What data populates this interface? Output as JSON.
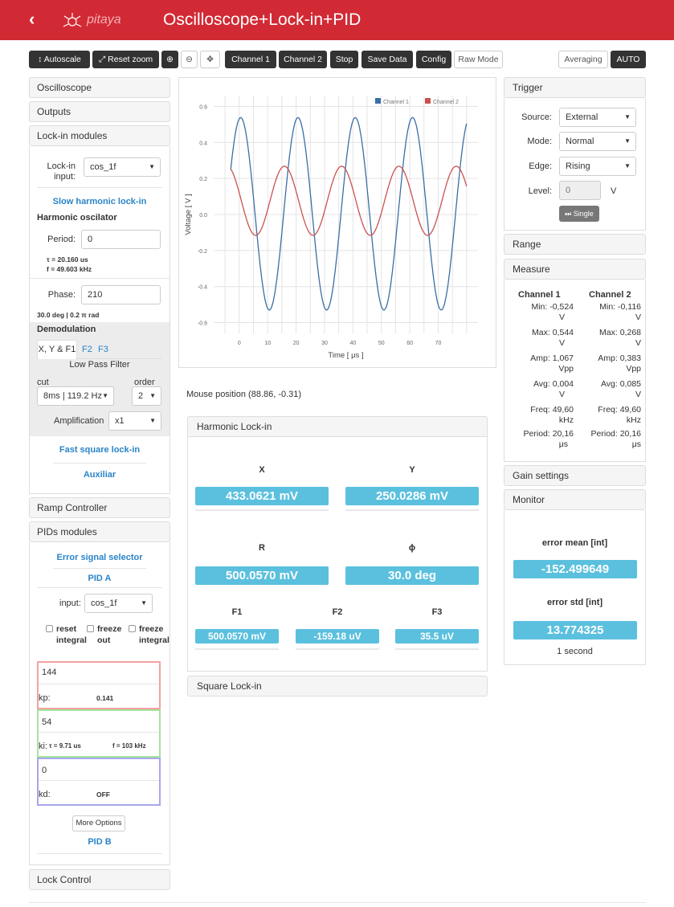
{
  "header": {
    "back_icon": "‹",
    "brand": "pitaya",
    "title": "Oscilloscope+Lock-in+PID"
  },
  "toolbar": {
    "autoscale": "Autoscale",
    "reset_zoom": "Reset zoom",
    "channel1": "Channel 1",
    "channel2": "Channel 2",
    "stop": "Stop",
    "save_data": "Save Data",
    "config": "Config",
    "raw_mode": "Raw Mode",
    "averaging": "Averaging",
    "auto": "AUTO"
  },
  "left": {
    "oscilloscope": "Oscilloscope",
    "outputs": "Outputs",
    "lockin_modules": "Lock-in modules",
    "lockin_input_label": "Lock-in",
    "lockin_input_label2": "input:",
    "lockin_input_value": "cos_1f",
    "slow_harmonic": "Slow harmonic lock-in",
    "harmonic_osc": "Harmonic oscilator",
    "period_label": "Period:",
    "period_value": "0",
    "tau": "τ = 20.160 us",
    "freq": "f = 49.603 kHz",
    "phase_label": "Phase:",
    "phase_value": "210",
    "phase_info": "30.0 deg | 0.2 π rad",
    "demodulation": "Demodulation",
    "tabs": [
      "X, Y & F1",
      "F2",
      "F3"
    ],
    "lpf": "Low Pass Filter",
    "cut_label": "cut",
    "order_label": "order",
    "cut_value": "8ms | 119.2 Hz",
    "order_value": "2",
    "amp_label": "Amplification",
    "amp_value": "x1",
    "fast_square": "Fast square lock-in",
    "auxiliar": "Auxiliar",
    "ramp": "Ramp Controller",
    "pids": "PIDs modules",
    "err_selector": "Error signal selector",
    "pid_a": "PID A",
    "pid_input_label": "input:",
    "pid_input_value": "cos_1f",
    "reset": "reset",
    "integral": "integral",
    "freeze": "freeze",
    "out": "out",
    "freeze2": "freeze",
    "integral2": "integral",
    "kp_value": "144",
    "kp_label": "kp:",
    "kp_info": "0.141",
    "ki_value": "54",
    "ki_label": "ki:",
    "ki_tau": "τ = 9.71 us",
    "ki_f": "f = 103 kHz",
    "kd_value": "0",
    "kd_label": "kd:",
    "kd_info": "OFF",
    "more_options": "More Options",
    "pid_b": "PID B",
    "lock_control": "Lock Control"
  },
  "mouse_position": "Mouse position (88.86, -0.31)",
  "harmonic": {
    "title": "Harmonic Lock-in",
    "x_label": "X",
    "x_value": "433.0621 mV",
    "y_label": "Y",
    "y_value": "250.0286 mV",
    "r_label": "R",
    "r_value": "500.0570 mV",
    "phi_label": "ϕ",
    "phi_value": "30.0  deg",
    "f1_label": "F1",
    "f1_value": "500.0570 mV",
    "f2_label": "F2",
    "f2_value": "-159.18 uV",
    "f3_label": "F3",
    "f3_value": "35.5 uV"
  },
  "square_lockin": "Square Lock-in",
  "trigger": {
    "title": "Trigger",
    "source_label": "Source:",
    "source_value": "External",
    "mode_label": "Mode:",
    "mode_value": "Normal",
    "edge_label": "Edge:",
    "edge_value": "Rising",
    "level_label": "Level:",
    "level_value": "0",
    "level_unit": "V",
    "single": "Single"
  },
  "range": "Range",
  "measure": {
    "title": "Measure",
    "ch1": "Channel 1",
    "ch2": "Channel 2",
    "min1": "Min: -0,524",
    "min2": "Min: -0,116",
    "max1": "Max: 0,544",
    "max2": "Max: 0,268",
    "amp1": "Amp: 1,067",
    "amp2": "Amp: 0,383",
    "avg1": "Avg: 0,004",
    "avg2": "Avg: 0,085",
    "freq1": "Freq: 49,60",
    "freq2": "Freq: 49,60",
    "period1": "Period: 20,16",
    "period2": "Period: 20,16",
    "u_v": "V",
    "u_vpp": "Vpp",
    "u_khz": "kHz",
    "u_us": "μs"
  },
  "gain_settings": "Gain settings",
  "monitor": {
    "title": "Monitor",
    "err_mean_label": "error mean [int]",
    "err_mean_value": "-152.499649",
    "err_std_label": "error std [int]",
    "err_std_value": "13.774325",
    "interval": "1 second"
  },
  "chart_data": {
    "type": "line",
    "xlabel": "Time [ μs ]",
    "ylabel": "Voltage [ V ]",
    "xlim": [
      -9,
      84
    ],
    "ylim": [
      -0.66,
      0.66
    ],
    "xticks": [
      0,
      10,
      20,
      30,
      40,
      50,
      60,
      70
    ],
    "yticks": [
      0.6,
      0.4,
      0.2,
      0.0,
      -0.2,
      -0.4,
      -0.6
    ],
    "ytick_labels": [
      "0.6",
      "0.4",
      "0.2",
      "0.0",
      "-0.2",
      "-0.4",
      "-0.6"
    ],
    "grid": true,
    "legend": "top-right",
    "series": [
      {
        "name": "Channel 1",
        "color": "#3b6ea5",
        "amplitude": 0.534,
        "offset": 0.004,
        "period": 20.16,
        "peak_at": 0.5
      },
      {
        "name": "Channel 2",
        "color": "#c9524f",
        "amplitude": 0.192,
        "offset": 0.076,
        "period": 20.16,
        "peak_at": -4.3
      }
    ]
  }
}
